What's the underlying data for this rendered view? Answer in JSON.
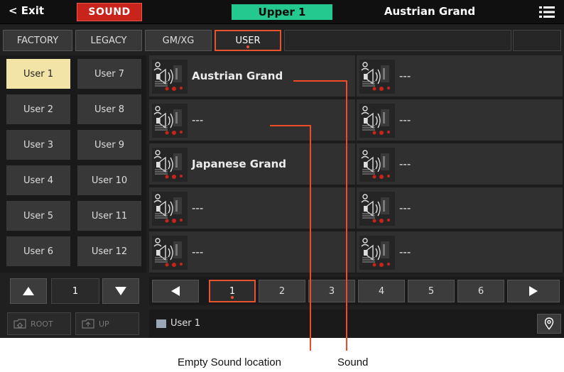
{
  "topbar": {
    "exit_label": "< Exit",
    "mode_label": "SOUND",
    "keyboard_part": "Upper 1",
    "current_sound": "Austrian Grand",
    "menu_icon": "hamburger-menu-icon"
  },
  "tabs": [
    {
      "label": "FACTORY",
      "active": false
    },
    {
      "label": "LEGACY",
      "active": false
    },
    {
      "label": "GM/XG",
      "active": false
    },
    {
      "label": "USER",
      "active": true
    }
  ],
  "banks": {
    "left": [
      "User 1",
      "User 2",
      "User 3",
      "User 4",
      "User 5",
      "User 6"
    ],
    "right": [
      "User 7",
      "User 8",
      "User 9",
      "User 10",
      "User 11",
      "User 12"
    ],
    "selected": "User 1",
    "page": "1",
    "up_arrow_icon": "up-triangle-icon",
    "down_arrow_icon": "down-triangle-icon"
  },
  "folders": {
    "root_label": "ROOT",
    "up_label": "UP"
  },
  "sounds": {
    "left": [
      "Austrian Grand",
      "---",
      "Japanese Grand",
      "---",
      "---"
    ],
    "right": [
      "---",
      "---",
      "---",
      "---",
      "---"
    ],
    "icon": "speaker-sound-icon"
  },
  "pages": {
    "items": [
      "1",
      "2",
      "3",
      "4",
      "5",
      "6"
    ],
    "active": "1",
    "prev_icon": "left-triangle-icon",
    "next_icon": "right-triangle-icon"
  },
  "path": {
    "folder_icon": "folder-icon",
    "label": "User 1",
    "pin_icon": "location-pin-icon"
  },
  "callouts": {
    "empty": "Empty Sound location",
    "sound": "Sound"
  },
  "colors": {
    "accent_red": "#c8241c",
    "highlight_orange": "#e8542f",
    "part_green": "#23c98f",
    "selected_bank": "#f2e4a6",
    "callout_line": "#ef4a2a"
  }
}
